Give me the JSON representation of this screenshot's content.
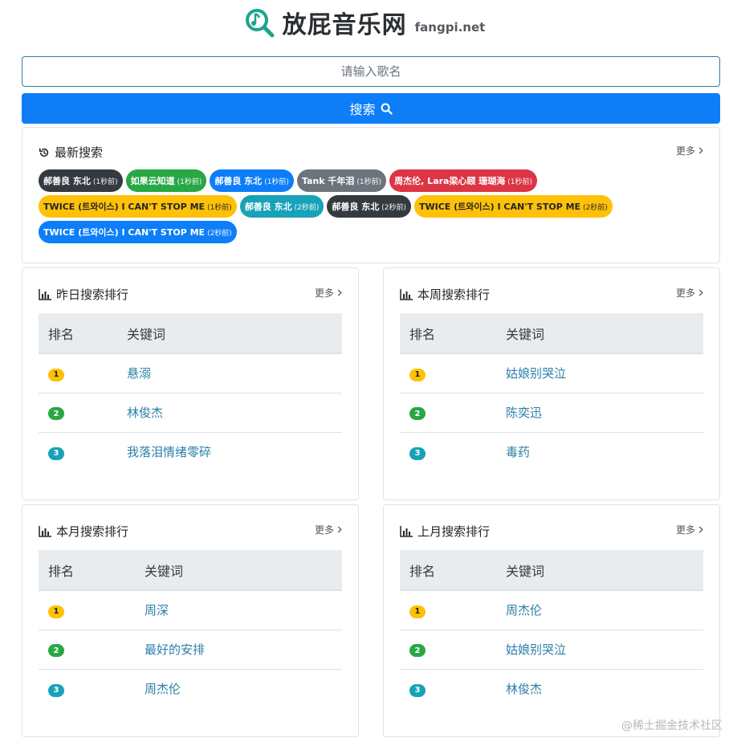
{
  "header": {
    "title": "放屁音乐网",
    "domain": "fangpi.net",
    "logo_icon": "music-search-icon",
    "logo_color": "#1aa58a"
  },
  "search": {
    "placeholder": "请输入歌名",
    "value": "",
    "button_label": "搜索"
  },
  "recent": {
    "title": "最新搜索",
    "more": "更多",
    "tags": [
      {
        "text": "郝善良 东北",
        "time": "(1秒前)",
        "color": "#343a40"
      },
      {
        "text": "如果云知道",
        "time": "(1秒前)",
        "color": "#28a745"
      },
      {
        "text": "郝善良 东北",
        "time": "(1秒前)",
        "color": "#0d7ef8"
      },
      {
        "text": "Tank 千年泪",
        "time": "(1秒前)",
        "color": "#6c757d"
      },
      {
        "text": "周杰伦, Lara梁心颐 珊瑚海",
        "time": "(1秒前)",
        "color": "#dc3545"
      },
      {
        "text": "TWICE (트와이스) I CAN'T STOP ME",
        "time": "(1秒前)",
        "color": "#ffc107"
      },
      {
        "text": "郝善良 东北",
        "time": "(2秒前)",
        "color": "#17a2b8"
      },
      {
        "text": "郝善良 东北",
        "time": "(2秒前)",
        "color": "#343a40"
      },
      {
        "text": "TWICE (트와이스) I CAN'T STOP ME",
        "time": "(2秒前)",
        "color": "#ffc107"
      },
      {
        "text": "TWICE (트와이스) I CAN'T STOP ME",
        "time": "(2秒前)",
        "color": "#0d7ef8"
      }
    ]
  },
  "rankings": [
    {
      "title": "昨日搜索排行",
      "more": "更多",
      "col_rank": "排名",
      "col_keyword": "关键词",
      "rows": [
        {
          "rank": "1",
          "keyword": "悬溺"
        },
        {
          "rank": "2",
          "keyword": "林俊杰"
        },
        {
          "rank": "3",
          "keyword": "我落泪情绪零碎"
        }
      ]
    },
    {
      "title": "本周搜索排行",
      "more": "更多",
      "col_rank": "排名",
      "col_keyword": "关键词",
      "rows": [
        {
          "rank": "1",
          "keyword": "姑娘别哭泣"
        },
        {
          "rank": "2",
          "keyword": "陈奕迅"
        },
        {
          "rank": "3",
          "keyword": "毒药"
        }
      ]
    },
    {
      "title": "本月搜索排行",
      "more": "更多",
      "col_rank": "排名",
      "col_keyword": "关键词",
      "rows": [
        {
          "rank": "1",
          "keyword": "周深"
        },
        {
          "rank": "2",
          "keyword": "最好的安排"
        },
        {
          "rank": "3",
          "keyword": "周杰伦"
        }
      ]
    },
    {
      "title": "上月搜索排行",
      "more": "更多",
      "col_rank": "排名",
      "col_keyword": "关键词",
      "rows": [
        {
          "rank": "1",
          "keyword": "周杰伦"
        },
        {
          "rank": "2",
          "keyword": "姑娘别哭泣"
        },
        {
          "rank": "3",
          "keyword": "林俊杰"
        }
      ]
    }
  ],
  "colors": {
    "primary": "#0d7ef8",
    "link": "#2b7fa8",
    "gold": "#ffc107",
    "green": "#28a745",
    "teal": "#17a2b8"
  },
  "watermark": "@稀土掘金技术社区"
}
